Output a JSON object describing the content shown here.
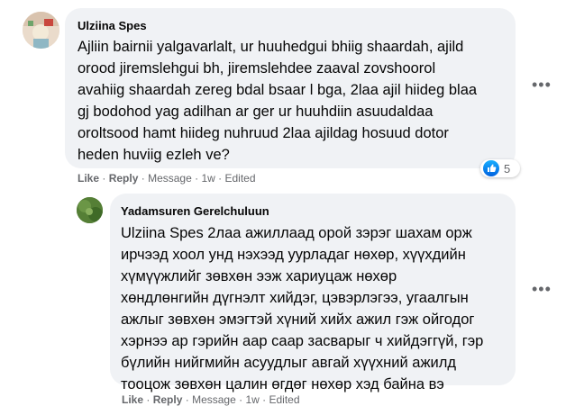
{
  "comment": {
    "author": "Ulziina Spes",
    "lines": [
      "Ajliin bairnii yalgavarlalt, ur huuhedgui bhiig shaardah, ajild",
      "orood jiremslehgui bh, jiremslehdee zaaval zovshoorol",
      "avahiig shaardah zereg bdal bsaar l bga, 2laa ajil hiideg blaa",
      "gj bodohod yag adilhan ar ger ur huuhdiin asuudaldaa",
      "oroltsood hamt hiideg nuhruud 2laa ajildag hosuud dotor",
      "heden huviig ezleh ve?"
    ],
    "actions": {
      "like": "Like",
      "reply": "Reply",
      "message": "Message",
      "time": "1w",
      "edited": "Edited",
      "sep": "·"
    },
    "reaction_count": "5",
    "reaction_icon": "like-icon",
    "more_icon": "more-options-icon"
  },
  "reply": {
    "author": "Yadamsuren Gerelchuluun",
    "lines": [
      "Ulziina Spes 2лаа ажиллаад орой зэрэг шахам орж",
      "ирчээд хоол унд нэхээд уурладаг нөхөр, хүүхдийн",
      "хүмүүжлийг зөвхөн ээж хариуцаж нөхөр",
      "хөндлөнгийн дүгнэлт хийдэг, цэвэрлэгээ, угаалгын",
      "ажлыг зөвхөн эмэгтэй хүний хийх ажил гэж ойгодог",
      "хэрнээ ар гэрийн аар саар засварыг ч хийдэггүй, гэр",
      "бүлийн нийгмийн асуудлыг авгай хүүхний ажилд",
      "тооцож зөвхөн цалин өгдөг нөхөр хэд байна вэ"
    ],
    "actions": {
      "like": "Like",
      "reply": "Reply",
      "message": "Message",
      "time": "1w",
      "edited": "Edited",
      "sep": "·"
    },
    "more_icon": "more-options-icon"
  },
  "colors": {
    "bubble_bg": "#f0f2f5",
    "meta_text": "#65676b",
    "body_text": "#050505",
    "like_blue": "#1877f2"
  }
}
